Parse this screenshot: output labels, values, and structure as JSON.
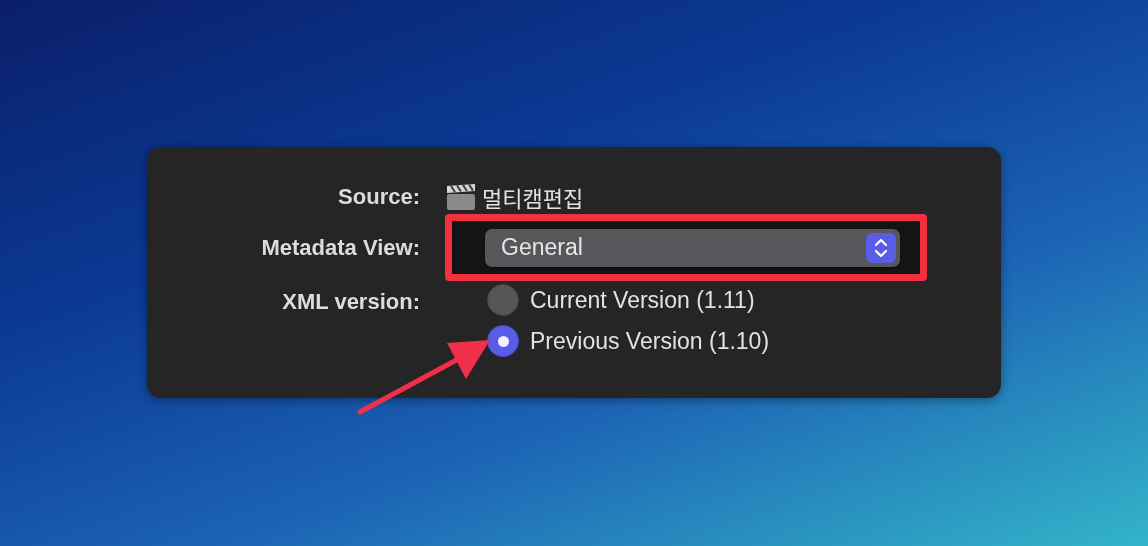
{
  "dialog": {
    "fields": [
      {
        "kind": "source",
        "label": "Source:",
        "value": "멀티캠편집"
      },
      {
        "kind": "popup",
        "label": "Metadata View:",
        "value": "General",
        "highlighted": true
      },
      {
        "kind": "radio",
        "label": "XML version:",
        "options": [
          {
            "label": "Current Version (1.11)",
            "selected": false
          },
          {
            "label": "Previous Version (1.10)",
            "selected": true
          }
        ]
      }
    ]
  }
}
